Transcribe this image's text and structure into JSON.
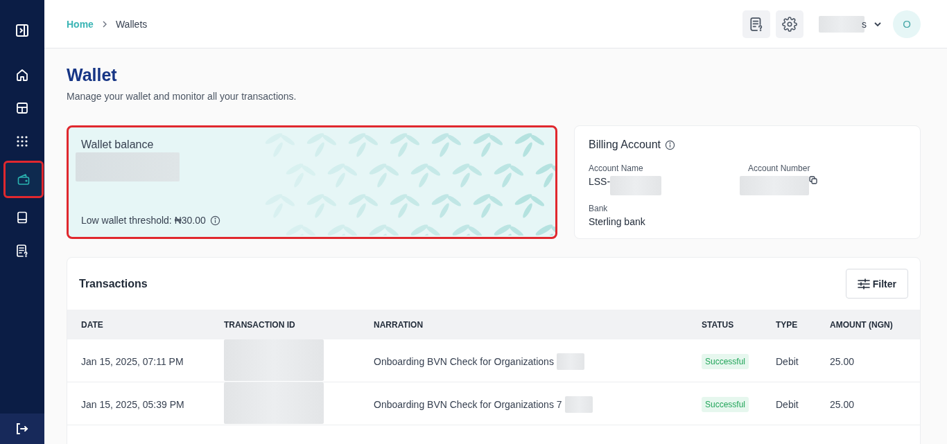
{
  "sidebar": {
    "items": [
      {
        "kind": "home",
        "selected": false,
        "highlighted": false
      },
      {
        "kind": "layout",
        "selected": false,
        "highlighted": false
      },
      {
        "kind": "apps",
        "selected": false,
        "highlighted": false
      },
      {
        "kind": "wallet",
        "selected": true,
        "highlighted": true
      },
      {
        "kind": "book",
        "selected": false,
        "highlighted": false
      },
      {
        "kind": "report",
        "selected": false,
        "highlighted": false
      }
    ]
  },
  "breadcrumbs": [
    {
      "label": "Home",
      "link": true
    },
    {
      "label": "Wallets",
      "link": false
    }
  ],
  "user": {
    "name": "s",
    "avatar": "O"
  },
  "page": {
    "title": "Wallet",
    "subtitle": "Manage your wallet and monitor all your transactions."
  },
  "wallet_card": {
    "label": "Wallet balance",
    "threshold": "Low wallet threshold: ₦30.00",
    "highlighted": true
  },
  "billing": {
    "title": "Billing Account",
    "fields": [
      {
        "label": "Account Name",
        "value": "LSS-",
        "copyable": false
      },
      {
        "label": "Account Number",
        "copyable": true
      },
      {
        "label": "Bank",
        "value": "Sterling bank",
        "copyable": false
      }
    ]
  },
  "transactions": {
    "title": "Transactions",
    "filter": "Filter",
    "columns": [
      "DATE",
      "TRANSACTION ID",
      "NARRATION",
      "STATUS",
      "TYPE",
      "AMOUNT (NGN)"
    ],
    "rows": [
      {
        "date": "Jan 15, 2025, 07:11 PM",
        "narration": "Onboarding BVN Check for Organizations",
        "status": "Successful",
        "type": "Debit",
        "amount": "25.00"
      },
      {
        "date": "Jan 15, 2025, 05:39 PM",
        "narration": "Onboarding BVN Check for Organizations 7",
        "status": "Successful",
        "type": "Debit",
        "amount": "25.00"
      }
    ]
  }
}
